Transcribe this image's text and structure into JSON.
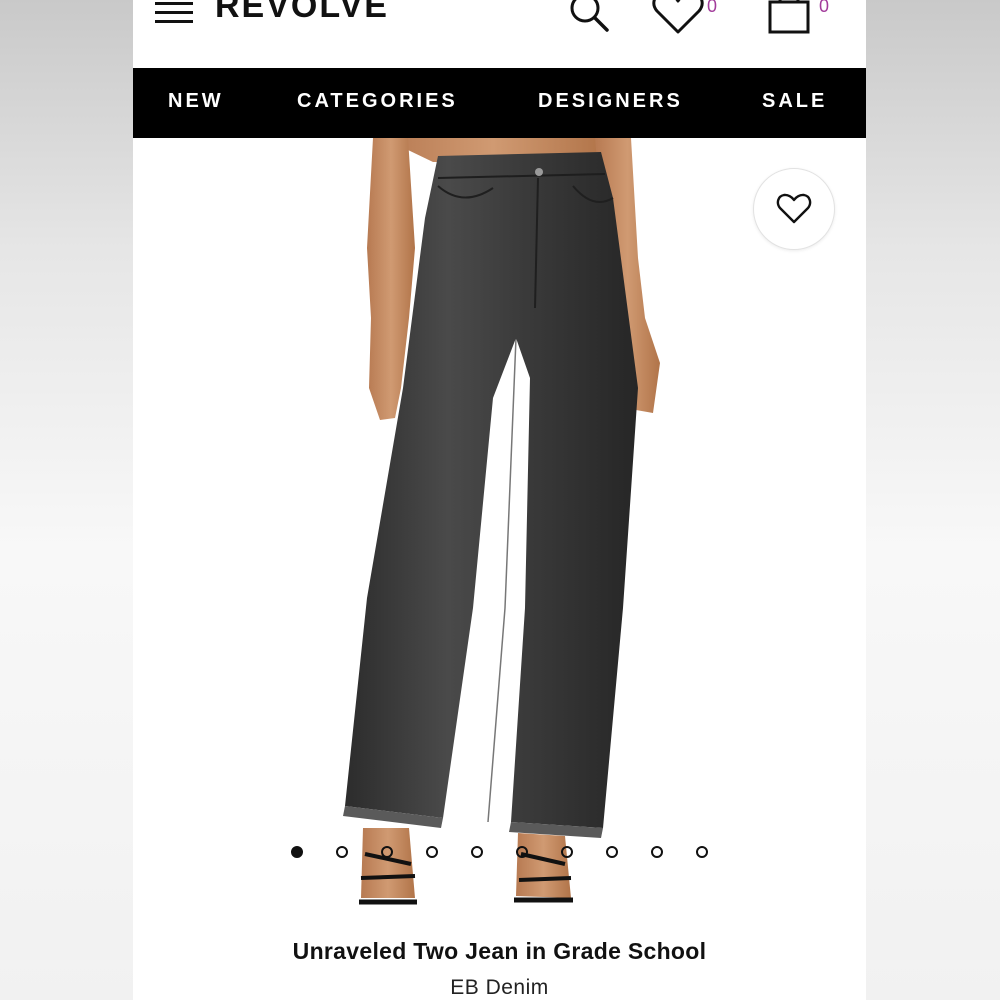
{
  "header": {
    "logo_text": "REVOLVE",
    "wishlist_count": "0",
    "bag_count": "0",
    "badge_color": "#a23c9b"
  },
  "nav": {
    "items": [
      {
        "label": "NEW"
      },
      {
        "label": "CATEGORIES"
      },
      {
        "label": "DESIGNERS"
      },
      {
        "label": "SALE"
      }
    ]
  },
  "carousel": {
    "total_images": 10,
    "active_index": 0
  },
  "product": {
    "title": "Unraveled Two Jean in Grade School",
    "brand": "EB Denim"
  },
  "icons": [
    "menu-icon",
    "search-icon",
    "heart-icon",
    "shopping-bag-icon"
  ]
}
